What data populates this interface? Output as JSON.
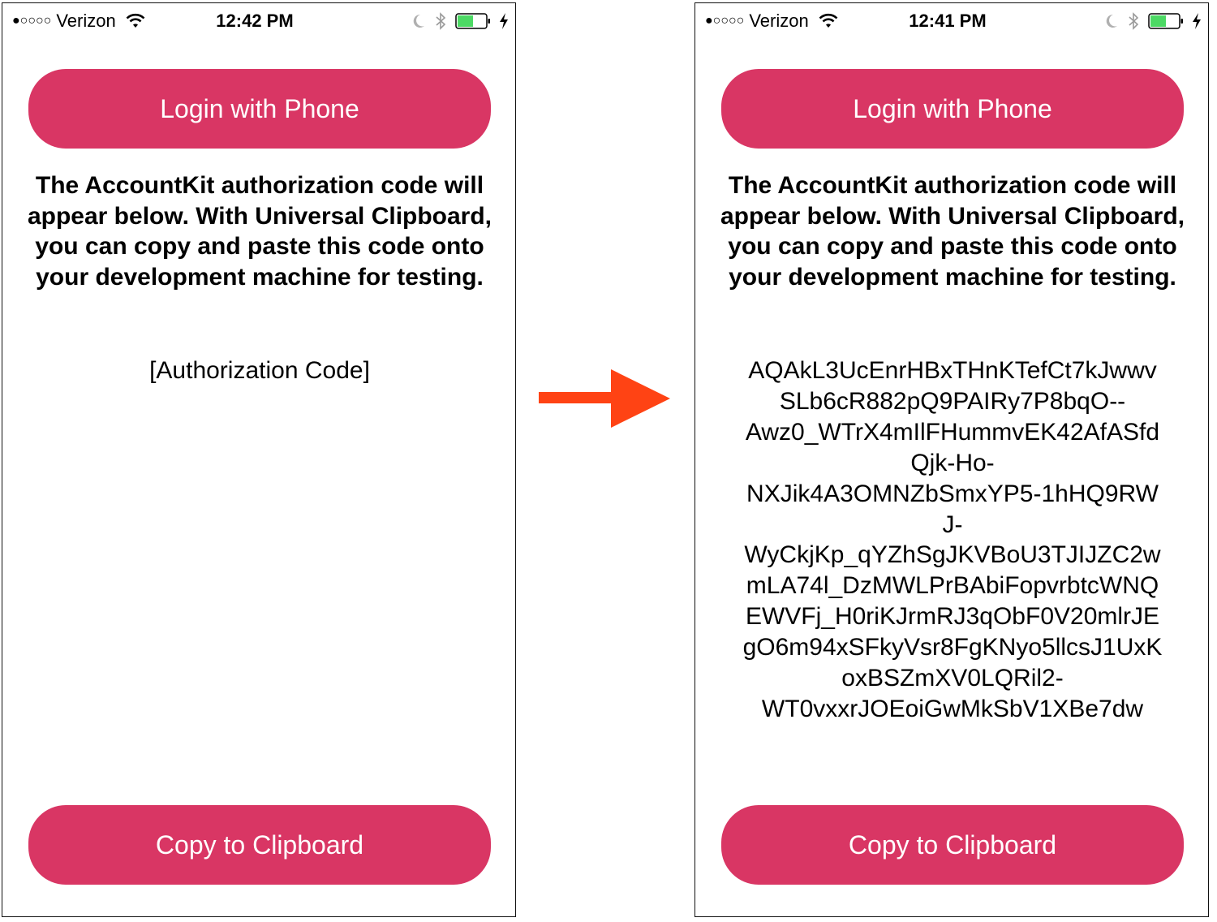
{
  "screens": {
    "before": {
      "status_bar": {
        "signal": "●○○○○",
        "carrier": "Verizon",
        "time": "12:42 PM",
        "icons": [
          "wifi-icon",
          "do-not-disturb-moon-icon",
          "bluetooth-icon",
          "battery-icon",
          "charging-bolt-icon"
        ],
        "battery_level_fraction": 0.55
      },
      "login_button": "Login with Phone",
      "description": "The AccountKit authorization code will appear below. With Universal Clipboard, you can copy and paste this code onto your development machine for testing.",
      "code_lines": [
        "[Authorization Code]"
      ],
      "copy_button": "Copy to Clipboard"
    },
    "after": {
      "status_bar": {
        "signal": "●○○○○",
        "carrier": "Verizon",
        "time": "12:41 PM",
        "icons": [
          "wifi-icon",
          "do-not-disturb-moon-icon",
          "bluetooth-icon",
          "battery-icon",
          "charging-bolt-icon"
        ],
        "battery_level_fraction": 0.55
      },
      "login_button": "Login with Phone",
      "description": "The AccountKit authorization code will appear below. With Universal Clipboard, you can copy and paste this code onto your development machine for testing.",
      "code_lines": [
        "AQAkL3UcEnrHBxTHnKTefCt7kJwwv",
        "SLb6cR882pQ9PAIRy7P8bqO--",
        "Awz0_WTrX4mIlFHummvEK42AfASfd",
        "Qjk-Ho-",
        "NXJik4A3OMNZbSmxYP5-1hHQ9RW",
        "J-",
        "WyCkjKp_qYZhSgJKVBoU3TJIJZC2w",
        "mLA74l_DzMWLPrBAbiFopvrbtcWNQ",
        "EWVFj_H0riKJrmRJ3qObF0V20mlrJE",
        "gO6m94xSFkyVsr8FgKNyo5llcsJ1UxK",
        "oxBSZmXV0LQRil2-",
        "WT0vxxrJOEoiGwMkSbV1XBe7dw"
      ],
      "copy_button": "Copy to Clipboard"
    }
  },
  "transition_arrow": {
    "icon": "right-arrow-icon",
    "color": "#FF4314"
  },
  "colors": {
    "button_bg": "#D93664",
    "button_text": "#FFFFFF",
    "battery_fill": "#4CD964"
  }
}
